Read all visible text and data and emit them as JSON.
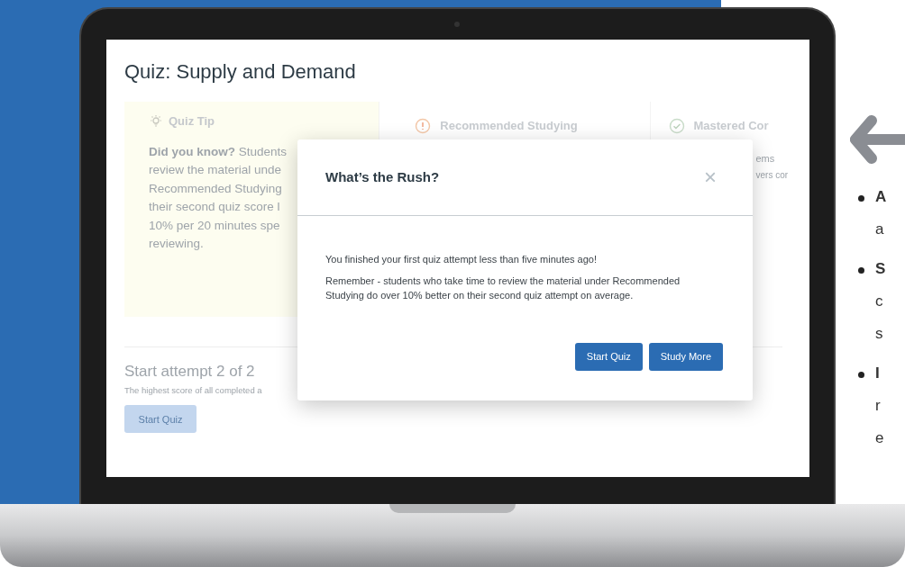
{
  "screen": {
    "title": "Quiz: Supply and Demand",
    "tip": {
      "heading": "Quiz Tip",
      "lines": [
        "**Did you know?** Students",
        "review the material unde",
        "Recommended Studying",
        "their second quiz score l",
        "10% per 20 minutes spe",
        "reviewing."
      ]
    },
    "columns": [
      {
        "kind": "alert",
        "heading": "Recommended Studying"
      },
      {
        "kind": "check",
        "heading": "Mastered Cor",
        "lines": [
          "ems",
          "vers cor"
        ]
      }
    ],
    "attempt": {
      "title": "Start attempt 2 of 2",
      "subtitle": "The highest score of all completed a",
      "button": "Start Quiz"
    },
    "modal": {
      "title": "What’s the Rush?",
      "close": "×",
      "paragraphs": [
        "You finished your first quiz attempt less than five minutes ago!",
        "Remember - students who take time to review the material under Recommended Studying do over 10% better on their second quiz attempt on average."
      ],
      "buttons": [
        "Start Quiz",
        "Study More"
      ]
    }
  },
  "bullets": [
    {
      "lines": [
        "A",
        "a"
      ]
    },
    {
      "lines": [
        "S",
        "c",
        "s"
      ]
    },
    {
      "lines": [
        "I",
        "r",
        "e"
      ]
    }
  ]
}
